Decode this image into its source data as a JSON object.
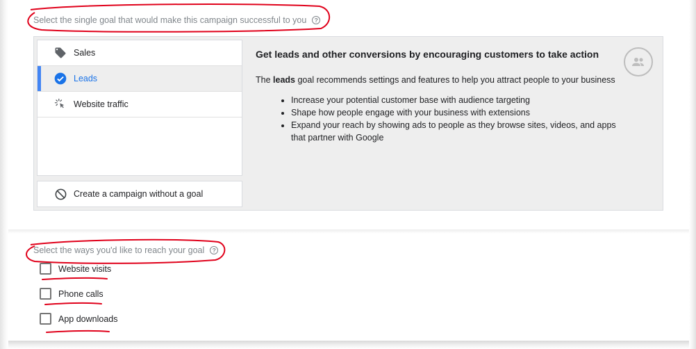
{
  "goal_question": {
    "text": "Select the single goal that would make this campaign successful to you",
    "help_icon": "?"
  },
  "goals": [
    {
      "label": "Sales",
      "icon": "tag-icon",
      "selected": false
    },
    {
      "label": "Leads",
      "icon": "check-circle-icon",
      "selected": true
    },
    {
      "label": "Website traffic",
      "icon": "cursor-click-icon",
      "selected": false
    }
  ],
  "no_goal": {
    "label": "Create a campaign without a goal",
    "icon": "block-icon"
  },
  "detail": {
    "heading": "Get leads and other conversions by encouraging customers to take action",
    "intro_prefix": "The ",
    "intro_bold": "leads",
    "intro_suffix": " goal recommends settings and features to help you attract people to your business",
    "bullets": [
      "Increase your potential customer base with audience targeting",
      "Shape how people engage with your business with extensions",
      "Expand your reach by showing ads to people as they browse sites, videos, and apps that partner with Google"
    ],
    "badge_icon": "people-icon"
  },
  "reach_question": {
    "text": "Select the ways you'd like to reach your goal",
    "help_icon": "?"
  },
  "reach_options": [
    {
      "label": "Website visits",
      "checked": false
    },
    {
      "label": "Phone calls",
      "checked": false
    },
    {
      "label": "App downloads",
      "checked": false
    }
  ],
  "colors": {
    "accent_blue": "#4285f4",
    "selected_text": "#1a73e8",
    "annotation_red": "#e0001a"
  }
}
